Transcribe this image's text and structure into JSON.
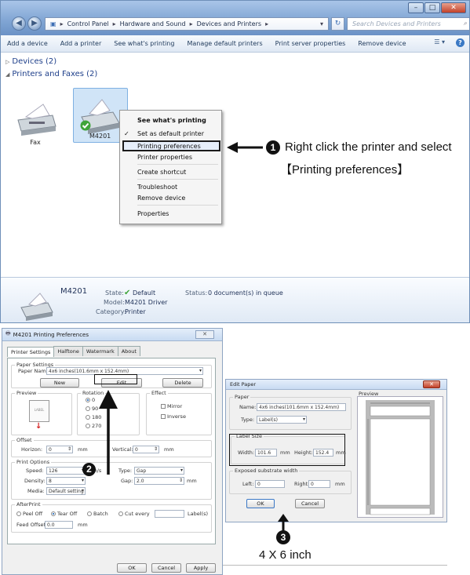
{
  "explorer": {
    "window_buttons": [
      "–",
      "□",
      "✕"
    ],
    "breadcrumb": [
      "Control Panel",
      "Hardware and Sound",
      "Devices and Printers"
    ],
    "search_placeholder": "Search Devices and Printers",
    "commands": [
      "Add a device",
      "Add a printer",
      "See what's printing",
      "Manage default printers",
      "Print server properties",
      "Remove device"
    ],
    "groups": {
      "devices": "Devices (2)",
      "printers": "Printers and Faxes (2)"
    },
    "devices": [
      {
        "label": "Fax",
        "icon": "fax-printer-icon"
      },
      {
        "label": "M4201",
        "icon": "label-printer-icon",
        "default": true
      }
    ],
    "context_menu": {
      "items": [
        "See what's printing",
        "Set as default printer",
        "Printing preferences",
        "Printer properties",
        "Create shortcut",
        "Troubleshoot",
        "Remove device",
        "Properties"
      ],
      "highlighted": "Printing preferences"
    },
    "details": {
      "name": "M4201",
      "state_label": "State:",
      "state_value": "Default",
      "model_label": "Model:",
      "model_value": "M4201 Driver",
      "category_label": "Category:",
      "category_value": "Printer",
      "status_label": "Status:",
      "status_value": "0 document(s) in queue"
    }
  },
  "callouts": {
    "step1": {
      "number": "1",
      "line1": "Right click the printer and select",
      "line2": "【Printing preferences】"
    },
    "step2": {
      "number": "2"
    },
    "step3": {
      "number": "3",
      "text": "4 X 6 inch"
    }
  },
  "prefs_dialog": {
    "title": "M4201 Printing Preferences",
    "tabs": [
      "Printer Settings",
      "Halftone",
      "Watermark",
      "About"
    ],
    "paper_settings": {
      "legend": "Paper Settings",
      "paper_name_label": "Paper Name:",
      "paper_name_value": "4x6 inches(101.6mm x 152.4mm)",
      "new": "New",
      "edit": "Edit",
      "delete": "Delete"
    },
    "preview_label": "Preview",
    "preview_caption": "LABEL",
    "rotation": {
      "legend": "Rotation",
      "options": [
        "0",
        "90",
        "180",
        "270"
      ],
      "selected": "0"
    },
    "effect": {
      "legend": "Effect",
      "options": [
        "Mirror",
        "Inverse"
      ]
    },
    "offset": {
      "legend": "Offset",
      "horizon_label": "Horizon:",
      "horizon_value": "0",
      "vertical_label": "Vertical:",
      "vertical_value": "0",
      "unit": "mm"
    },
    "print_options": {
      "legend": "Print Options",
      "speed_label": "Speed:",
      "speed_value": "126",
      "speed_unit": "mm/s",
      "density_label": "Density:",
      "density_value": "8",
      "media_label": "Media:",
      "media_value": "Default setting",
      "type_label": "Type:",
      "type_value": "Gap",
      "gap_label": "Gap:",
      "gap_value": "2.0",
      "gap_unit": "mm"
    },
    "afterprint": {
      "legend": "AfterPrint",
      "options": [
        "Peel Off",
        "Tear Off",
        "Batch",
        "Cut every"
      ],
      "selected": "Tear Off",
      "labels_suffix": "Label(s)",
      "feed_offset_label": "Feed Offset:",
      "feed_offset_value": "0.0",
      "feed_offset_unit": "mm"
    },
    "buttons": {
      "ok": "OK",
      "cancel": "Cancel",
      "apply": "Apply"
    }
  },
  "edit_paper_dialog": {
    "title": "Edit Paper",
    "paper_legend": "Paper",
    "name_label": "Name:",
    "name_value": "4x6 inches(101.6mm x 152.4mm)",
    "type_label": "Type:",
    "type_value": "Label(s)",
    "label_size_legend": "Label Size",
    "width_label": "Width:",
    "width_value": "101.6",
    "width_unit": "mm",
    "height_label": "Height:",
    "height_value": "152.4",
    "height_unit": "mm",
    "exposed_legend": "Exposed substrate width",
    "left_label": "Left:",
    "left_value": "0",
    "right_label": "Right:",
    "right_value": "0",
    "lr_unit": "mm",
    "preview_legend": "Preview",
    "ok": "OK",
    "cancel": "Cancel"
  }
}
